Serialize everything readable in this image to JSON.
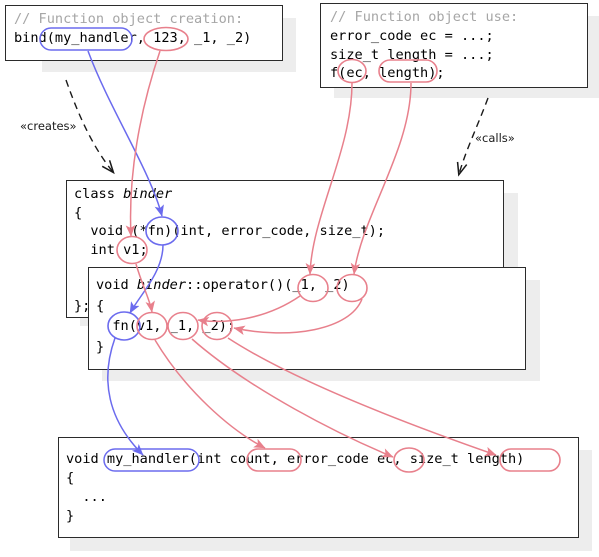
{
  "diagram": {
    "title": "C++ bind function object creation and use",
    "colors": {
      "red": "#e8808c",
      "blue": "#6b6bee",
      "black": "#2b2b2b",
      "comment_gray": "#a6a6a6",
      "shadow_gray": "#ededed"
    }
  },
  "boxes": {
    "creation": {
      "name": "function-object-creation",
      "comment": "// Function object creation:",
      "lines": [
        {
          "pre": "bind(",
          "hl_blue": "my_handler",
          "mid": ", ",
          "hl_red": "123",
          "post": ", _1, _2)"
        }
      ],
      "plain_line": "bind(my_handler, 123, _1, _2)"
    },
    "use": {
      "name": "function-object-use",
      "comment": "// Function object use:",
      "line1": "error_code ec = ...;",
      "line2": "size_t length = ...;",
      "line3": "f(ec, length);"
    },
    "binder_class": {
      "name": "class-binder",
      "line1_kw": "class ",
      "line1_name": "binder",
      "line2": "{",
      "line3": "  void (*fn)(int, error_code, size_t);",
      "line4": "  int v1;",
      "line5": "};"
    },
    "binder_operator": {
      "name": "binder-operator-call",
      "line1_kw": "void ",
      "line1_name": "binder",
      "line1_rest": "::operator()(_1, _2)",
      "line2": "{",
      "line3": "  fn(v1, _1, _2);",
      "line4": "}"
    },
    "handler": {
      "name": "my-handler-definition",
      "line1": "void my_handler(int count, error_code ec, size_t length)",
      "line2": "{",
      "line3": "  ...",
      "line4": "}"
    }
  },
  "annotations": {
    "creates": "«creates»",
    "calls": "«calls»"
  },
  "highlights": {
    "bind_my_handler": "my_handler",
    "bind_123": "123",
    "use_ec": "ec",
    "use_length": "length",
    "binder_fn": "fn",
    "binder_v1": "v1",
    "op_sig_1": "_1",
    "op_sig_2": "_2",
    "body_fn": "fn",
    "body_v1": "v1",
    "body_1": "_1",
    "body_2": "_2",
    "handler_name": "my_handler",
    "handler_count": "count",
    "handler_ec": "ec",
    "handler_length": "length"
  }
}
